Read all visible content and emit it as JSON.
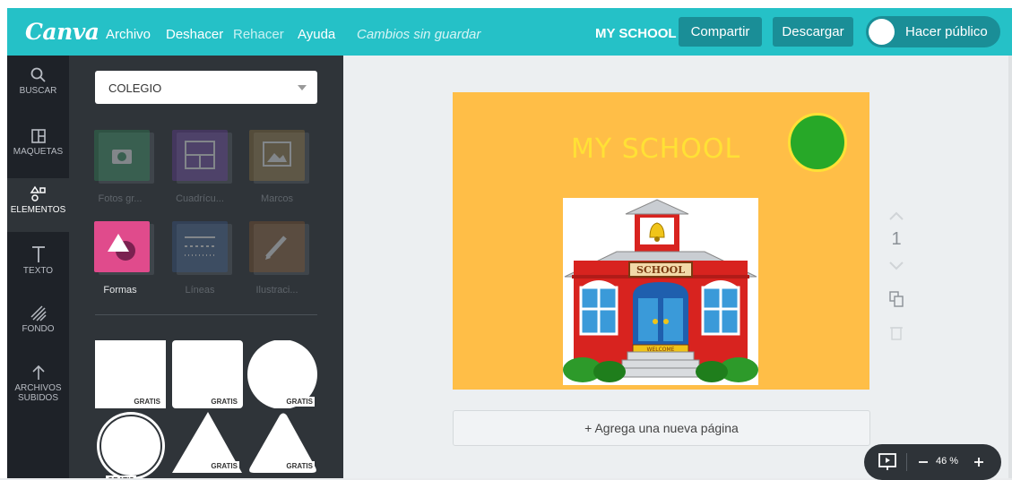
{
  "app": {
    "logo": "Canva"
  },
  "menu": {
    "archivo": "Archivo",
    "deshacer": "Deshacer",
    "rehacer": "Rehacer",
    "ayuda": "Ayuda",
    "status": "Cambios sin guardar"
  },
  "header": {
    "doc_title": "MY SCHOOL",
    "share": "Compartir",
    "download": "Descargar",
    "make_public": "Hacer público"
  },
  "sidebar": {
    "items": [
      {
        "label": "BUSCAR",
        "icon": "search-icon"
      },
      {
        "label": "MAQUETAS",
        "icon": "layout-icon"
      },
      {
        "label": "ELEMENTOS",
        "icon": "shapes-icon"
      },
      {
        "label": "TEXTO",
        "icon": "text-icon"
      },
      {
        "label": "FONDO",
        "icon": "background-icon"
      },
      {
        "label1": "ARCHIVOS",
        "label2": "SUBIDOS",
        "icon": "upload-icon"
      }
    ]
  },
  "panel": {
    "search_value": "COLEGIO",
    "categories": [
      {
        "label": "Fotos gr...",
        "icon": "camera-icon",
        "color": "#2f8f5b"
      },
      {
        "label": "Cuadrícu...",
        "icon": "grid-icon",
        "color": "#6c3fa3"
      },
      {
        "label": "Marcos",
        "icon": "frame-icon",
        "color": "#9a7a3e"
      },
      {
        "label": "Formas",
        "icon": "shape-icon",
        "color": "#e04b8c"
      },
      {
        "label": "Líneas",
        "icon": "lines-icon",
        "color": "#3b5c8f"
      },
      {
        "label": "Ilustraci...",
        "icon": "pencil-icon",
        "color": "#8c5a2c"
      }
    ],
    "free_label": "GRATIS"
  },
  "design": {
    "page_title": "MY SCHOOL",
    "school_sign": "SCHOOL",
    "welcome_sign": "WELCOME",
    "page_number": "1",
    "add_page": "+ Agrega una nueva página"
  },
  "zoom": {
    "value": "46 %"
  }
}
